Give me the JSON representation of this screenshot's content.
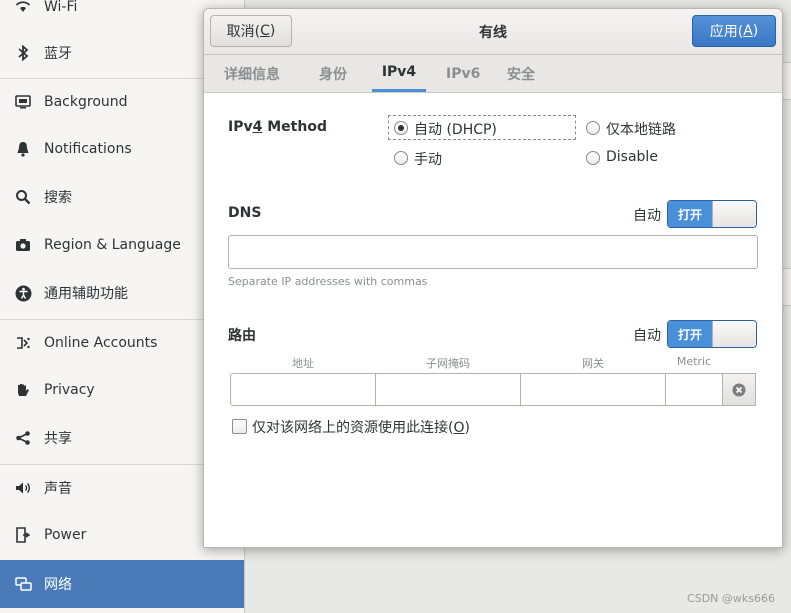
{
  "sidebar": {
    "items": [
      {
        "label": "Wi-Fi",
        "icon": "wifi-icon"
      },
      {
        "label": "蓝牙",
        "icon": "bluetooth-icon"
      },
      {
        "label": "Background",
        "icon": "background-icon"
      },
      {
        "label": "Notifications",
        "icon": "bell-icon"
      },
      {
        "label": "搜索",
        "icon": "search-icon"
      },
      {
        "label": "Region & Language",
        "icon": "camera-icon"
      },
      {
        "label": "通用辅助功能",
        "icon": "accessibility-icon"
      },
      {
        "label": "Online Accounts",
        "icon": "online-accounts-icon"
      },
      {
        "label": "Privacy",
        "icon": "hand-icon"
      },
      {
        "label": "共享",
        "icon": "share-icon"
      },
      {
        "label": "声音",
        "icon": "speaker-icon"
      },
      {
        "label": "Power",
        "icon": "power-icon"
      },
      {
        "label": "网络",
        "icon": "network-icon"
      }
    ],
    "selected": "网络"
  },
  "dialog": {
    "title": "有线",
    "cancel_prefix": "取消(",
    "cancel_key": "C",
    "cancel_suffix": ")",
    "apply_prefix": "应用(",
    "apply_key": "A",
    "apply_suffix": ")",
    "tabs": [
      "详细信息",
      "身份",
      "IPv4",
      "IPv6",
      "安全"
    ],
    "active_tab": "IPv4"
  },
  "ipv4": {
    "method_label_pre": "IPv",
    "method_label_key": "4",
    "method_label_post": " Method",
    "methods": [
      {
        "label": "自动 (DHCP)",
        "checked": true
      },
      {
        "label": "仅本地链路",
        "checked": false
      },
      {
        "label": "手动",
        "checked": false
      },
      {
        "label": "Disable",
        "checked": false
      }
    ],
    "dns": {
      "label": "DNS",
      "auto_label": "自动",
      "toggle_on": "打开",
      "value": "",
      "hint": "Separate IP addresses with commas"
    },
    "routes": {
      "label": "路由",
      "auto_label": "自动",
      "toggle_on": "打开",
      "columns": [
        "地址",
        "子网掩码",
        "网关",
        "Metric"
      ]
    },
    "only_local": {
      "label_pre": "仅对该网络上的资源使用此连接(",
      "label_key": "O",
      "label_post": ")",
      "checked": false
    }
  },
  "watermark": "CSDN @wks666",
  "colors": {
    "accent": "#4a90d9",
    "selected": "#4a7bb8"
  }
}
